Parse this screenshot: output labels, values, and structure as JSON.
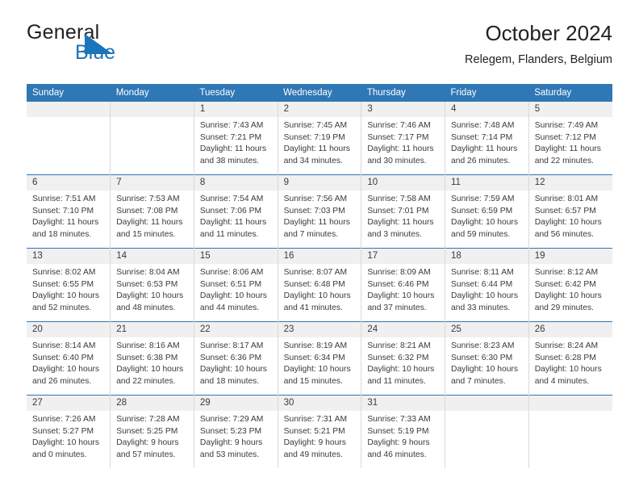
{
  "brand": {
    "name_top": "General",
    "name_bottom": "Blue",
    "flag_color": "#1a75bb",
    "text_color": "#231f20"
  },
  "header": {
    "title": "October 2024",
    "location": "Relegem, Flanders, Belgium"
  },
  "theme": {
    "header_bar": "#2f77b5",
    "day_strip": "#f0f0f0",
    "grid_line": "#d9d9d9",
    "text": "#3a3a3a"
  },
  "weekdays": [
    "Sunday",
    "Monday",
    "Tuesday",
    "Wednesday",
    "Thursday",
    "Friday",
    "Saturday"
  ],
  "weeks": [
    [
      {
        "day": "",
        "empty": true
      },
      {
        "day": "",
        "empty": true
      },
      {
        "day": "1",
        "sunrise": "Sunrise: 7:43 AM",
        "sunset": "Sunset: 7:21 PM",
        "daylight": "Daylight: 11 hours and 38 minutes."
      },
      {
        "day": "2",
        "sunrise": "Sunrise: 7:45 AM",
        "sunset": "Sunset: 7:19 PM",
        "daylight": "Daylight: 11 hours and 34 minutes."
      },
      {
        "day": "3",
        "sunrise": "Sunrise: 7:46 AM",
        "sunset": "Sunset: 7:17 PM",
        "daylight": "Daylight: 11 hours and 30 minutes."
      },
      {
        "day": "4",
        "sunrise": "Sunrise: 7:48 AM",
        "sunset": "Sunset: 7:14 PM",
        "daylight": "Daylight: 11 hours and 26 minutes."
      },
      {
        "day": "5",
        "sunrise": "Sunrise: 7:49 AM",
        "sunset": "Sunset: 7:12 PM",
        "daylight": "Daylight: 11 hours and 22 minutes."
      }
    ],
    [
      {
        "day": "6",
        "sunrise": "Sunrise: 7:51 AM",
        "sunset": "Sunset: 7:10 PM",
        "daylight": "Daylight: 11 hours and 18 minutes."
      },
      {
        "day": "7",
        "sunrise": "Sunrise: 7:53 AM",
        "sunset": "Sunset: 7:08 PM",
        "daylight": "Daylight: 11 hours and 15 minutes."
      },
      {
        "day": "8",
        "sunrise": "Sunrise: 7:54 AM",
        "sunset": "Sunset: 7:06 PM",
        "daylight": "Daylight: 11 hours and 11 minutes."
      },
      {
        "day": "9",
        "sunrise": "Sunrise: 7:56 AM",
        "sunset": "Sunset: 7:03 PM",
        "daylight": "Daylight: 11 hours and 7 minutes."
      },
      {
        "day": "10",
        "sunrise": "Sunrise: 7:58 AM",
        "sunset": "Sunset: 7:01 PM",
        "daylight": "Daylight: 11 hours and 3 minutes."
      },
      {
        "day": "11",
        "sunrise": "Sunrise: 7:59 AM",
        "sunset": "Sunset: 6:59 PM",
        "daylight": "Daylight: 10 hours and 59 minutes."
      },
      {
        "day": "12",
        "sunrise": "Sunrise: 8:01 AM",
        "sunset": "Sunset: 6:57 PM",
        "daylight": "Daylight: 10 hours and 56 minutes."
      }
    ],
    [
      {
        "day": "13",
        "sunrise": "Sunrise: 8:02 AM",
        "sunset": "Sunset: 6:55 PM",
        "daylight": "Daylight: 10 hours and 52 minutes."
      },
      {
        "day": "14",
        "sunrise": "Sunrise: 8:04 AM",
        "sunset": "Sunset: 6:53 PM",
        "daylight": "Daylight: 10 hours and 48 minutes."
      },
      {
        "day": "15",
        "sunrise": "Sunrise: 8:06 AM",
        "sunset": "Sunset: 6:51 PM",
        "daylight": "Daylight: 10 hours and 44 minutes."
      },
      {
        "day": "16",
        "sunrise": "Sunrise: 8:07 AM",
        "sunset": "Sunset: 6:48 PM",
        "daylight": "Daylight: 10 hours and 41 minutes."
      },
      {
        "day": "17",
        "sunrise": "Sunrise: 8:09 AM",
        "sunset": "Sunset: 6:46 PM",
        "daylight": "Daylight: 10 hours and 37 minutes."
      },
      {
        "day": "18",
        "sunrise": "Sunrise: 8:11 AM",
        "sunset": "Sunset: 6:44 PM",
        "daylight": "Daylight: 10 hours and 33 minutes."
      },
      {
        "day": "19",
        "sunrise": "Sunrise: 8:12 AM",
        "sunset": "Sunset: 6:42 PM",
        "daylight": "Daylight: 10 hours and 29 minutes."
      }
    ],
    [
      {
        "day": "20",
        "sunrise": "Sunrise: 8:14 AM",
        "sunset": "Sunset: 6:40 PM",
        "daylight": "Daylight: 10 hours and 26 minutes."
      },
      {
        "day": "21",
        "sunrise": "Sunrise: 8:16 AM",
        "sunset": "Sunset: 6:38 PM",
        "daylight": "Daylight: 10 hours and 22 minutes."
      },
      {
        "day": "22",
        "sunrise": "Sunrise: 8:17 AM",
        "sunset": "Sunset: 6:36 PM",
        "daylight": "Daylight: 10 hours and 18 minutes."
      },
      {
        "day": "23",
        "sunrise": "Sunrise: 8:19 AM",
        "sunset": "Sunset: 6:34 PM",
        "daylight": "Daylight: 10 hours and 15 minutes."
      },
      {
        "day": "24",
        "sunrise": "Sunrise: 8:21 AM",
        "sunset": "Sunset: 6:32 PM",
        "daylight": "Daylight: 10 hours and 11 minutes."
      },
      {
        "day": "25",
        "sunrise": "Sunrise: 8:23 AM",
        "sunset": "Sunset: 6:30 PM",
        "daylight": "Daylight: 10 hours and 7 minutes."
      },
      {
        "day": "26",
        "sunrise": "Sunrise: 8:24 AM",
        "sunset": "Sunset: 6:28 PM",
        "daylight": "Daylight: 10 hours and 4 minutes."
      }
    ],
    [
      {
        "day": "27",
        "sunrise": "Sunrise: 7:26 AM",
        "sunset": "Sunset: 5:27 PM",
        "daylight": "Daylight: 10 hours and 0 minutes."
      },
      {
        "day": "28",
        "sunrise": "Sunrise: 7:28 AM",
        "sunset": "Sunset: 5:25 PM",
        "daylight": "Daylight: 9 hours and 57 minutes."
      },
      {
        "day": "29",
        "sunrise": "Sunrise: 7:29 AM",
        "sunset": "Sunset: 5:23 PM",
        "daylight": "Daylight: 9 hours and 53 minutes."
      },
      {
        "day": "30",
        "sunrise": "Sunrise: 7:31 AM",
        "sunset": "Sunset: 5:21 PM",
        "daylight": "Daylight: 9 hours and 49 minutes."
      },
      {
        "day": "31",
        "sunrise": "Sunrise: 7:33 AM",
        "sunset": "Sunset: 5:19 PM",
        "daylight": "Daylight: 9 hours and 46 minutes."
      },
      {
        "day": "",
        "empty": true
      },
      {
        "day": "",
        "empty": true
      }
    ]
  ]
}
